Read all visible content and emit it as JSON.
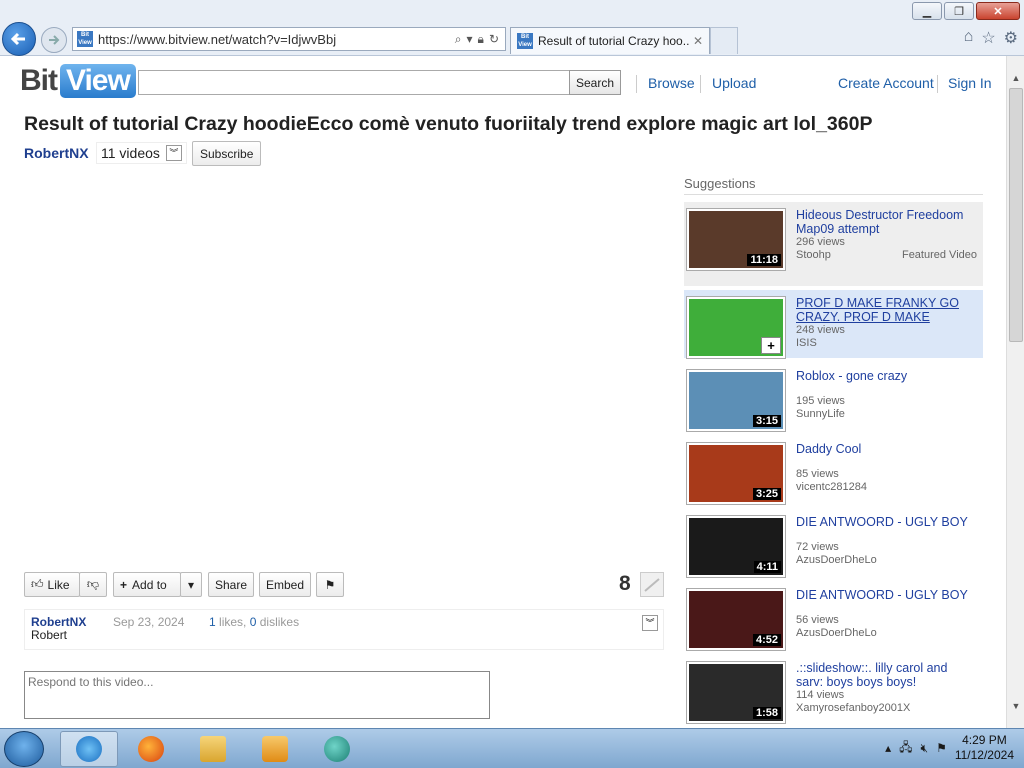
{
  "browser": {
    "url": "https://www.bitview.net/watch?v=IdjwvBbj",
    "tab_title": "Result of tutorial Crazy hoo...",
    "favicon_text": "Bit View"
  },
  "site": {
    "logo_bit": "Bit",
    "logo_view": "View",
    "search_button": "Search",
    "nav": {
      "browse": "Browse",
      "upload": "Upload",
      "create_account": "Create Account",
      "sign_in": "Sign In"
    }
  },
  "video": {
    "title": "Result of tutorial Crazy hoodieEcco comè venuto fuoriitaly trend explore magic art lol_360P",
    "uploader": "RobertNX",
    "videos_count": "11 videos",
    "subscribe": "Subscribe",
    "actions": {
      "like": "Like",
      "add_to": "Add to",
      "share": "Share",
      "embed": "Embed"
    },
    "views": "8",
    "info": {
      "user": "RobertNX",
      "date": "Sep 23, 2024",
      "likes_num": "1",
      "likes_word": "likes,",
      "dislikes_num": "0",
      "dislikes_word": "dislikes",
      "description": "Robert"
    },
    "comment_placeholder": "Respond to this video..."
  },
  "suggestions": {
    "heading": "Suggestions",
    "items": [
      {
        "title": "Hideous Destructor Freedoom Map09 attempt",
        "views": "296 views",
        "user": "Stoohp",
        "duration": "11:18",
        "featured": "Featured Video",
        "thumb_color": "#5a3a2a"
      },
      {
        "title": "PROF D MAKE FRANKY GO CRAZY. PROF D MAKE",
        "views": "248 views",
        "user": "ISIS",
        "duration": "+",
        "thumb_color": "#3fae3a"
      },
      {
        "title": "Roblox - gone crazy",
        "views": "195 views",
        "user": "SunnyLife",
        "duration": "3:15",
        "thumb_color": "#5c8fb6"
      },
      {
        "title": "Daddy Cool",
        "views": "85 views",
        "user": "vicentc281284",
        "duration": "3:25",
        "thumb_color": "#a83a1a"
      },
      {
        "title": "DIE ANTWOORD - UGLY BOY",
        "views": "72 views",
        "user": "AzusDoerDheLo",
        "duration": "4:11",
        "thumb_color": "#1a1a1a"
      },
      {
        "title": "DIE ANTWOORD - UGLY BOY",
        "views": "56 views",
        "user": "AzusDoerDheLo",
        "duration": "4:52",
        "thumb_color": "#4a1818"
      },
      {
        "title": ".::slideshow::. lilly carol and sarv: boys boys boys!",
        "views": "114 views",
        "user": "Xamyrosefanboy2001X",
        "duration": "1:58",
        "thumb_color": "#2a2a2a"
      }
    ]
  },
  "taskbar": {
    "time": "4:29 PM",
    "date": "11/12/2024"
  },
  "colors": {
    "link": "#1f5fa8",
    "hover_bg": "#dbe7f8",
    "featured_bg": "#eeeeee"
  }
}
